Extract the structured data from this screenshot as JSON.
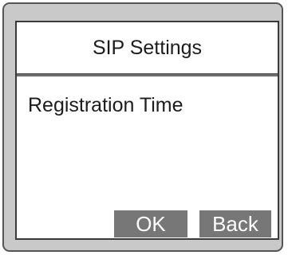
{
  "screen": {
    "title": "SIP Settings",
    "selected_item": "Registration Time"
  },
  "softkeys": {
    "ok_label": "OK",
    "back_label": "Back"
  }
}
